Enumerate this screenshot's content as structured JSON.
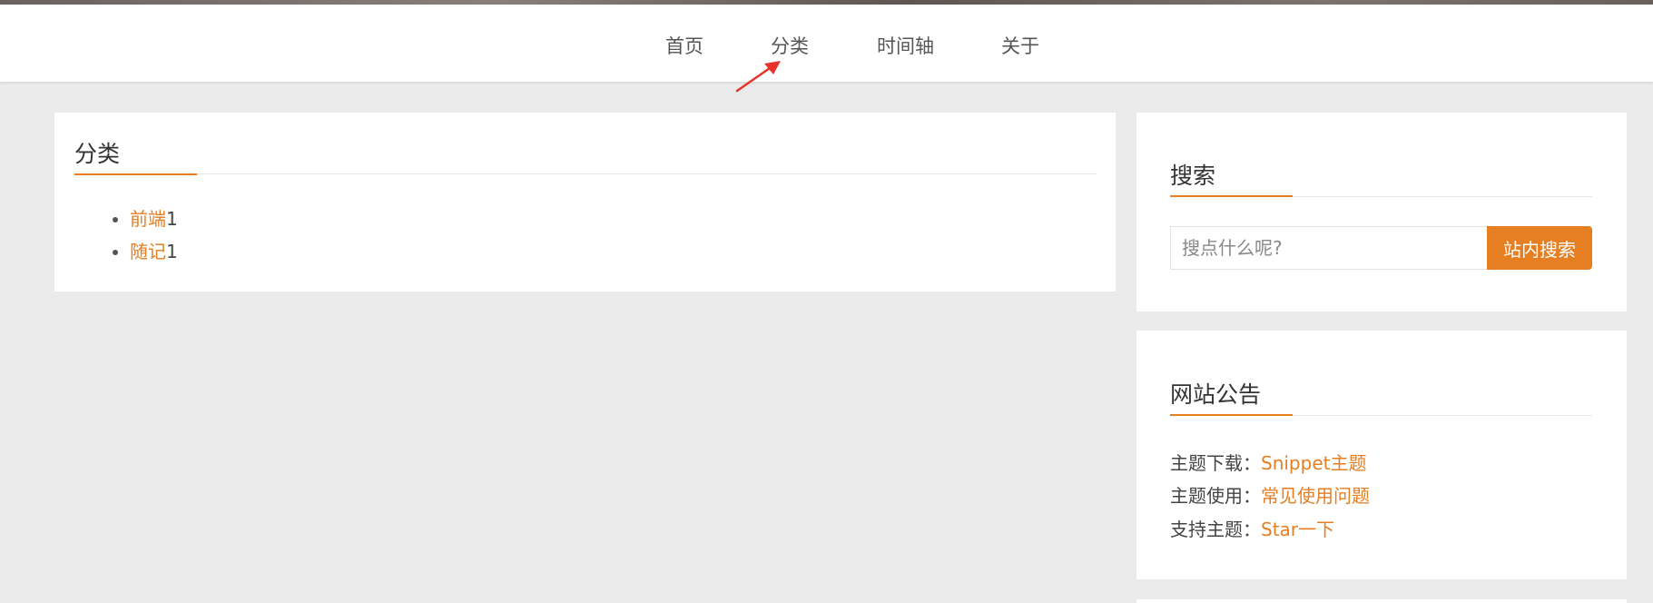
{
  "nav": {
    "items": [
      "首页",
      "分类",
      "时间轴",
      "关于"
    ]
  },
  "categories_card": {
    "title": "分类",
    "items": [
      {
        "name": "前端",
        "count": "1"
      },
      {
        "name": "随记",
        "count": "1"
      }
    ]
  },
  "search_card": {
    "title": "搜索",
    "placeholder": "搜点什么呢?",
    "button_label": "站内搜索"
  },
  "notice_card": {
    "title": "网站公告",
    "lines": [
      {
        "label": "主题下载：",
        "link": "Snippet主题"
      },
      {
        "label": "主题使用：",
        "link": "常见使用问题"
      },
      {
        "label": "支持主题：",
        "link": "Star一下"
      }
    ]
  },
  "colors": {
    "accent": "#e67e22",
    "background": "#ebebeb",
    "arrow": "#e8332a"
  },
  "icons": [
    "red-arrow-icon"
  ]
}
